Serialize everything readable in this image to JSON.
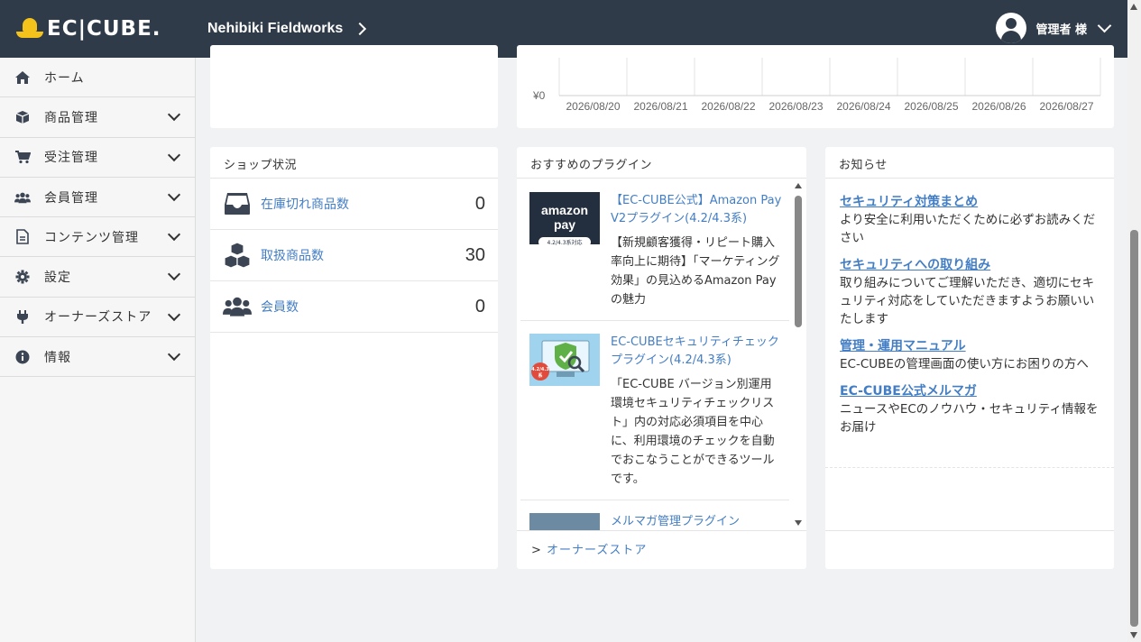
{
  "header": {
    "logo_text": "EC|CUBE.",
    "shop_name": "Nehibiki Fieldworks",
    "user_name": "管理者 様"
  },
  "sidebar": {
    "items": [
      {
        "label": "ホーム",
        "icon": "home-icon"
      },
      {
        "label": "商品管理",
        "icon": "box-icon"
      },
      {
        "label": "受注管理",
        "icon": "cart-icon"
      },
      {
        "label": "会員管理",
        "icon": "users-icon"
      },
      {
        "label": "コンテンツ管理",
        "icon": "document-icon"
      },
      {
        "label": "設定",
        "icon": "gear-icon"
      },
      {
        "label": "オーナーズストア",
        "icon": "plug-icon"
      },
      {
        "label": "情報",
        "icon": "info-icon"
      }
    ]
  },
  "chart_data": {
    "type": "line",
    "y_tick_label": "¥0",
    "categories": [
      "2026/08/20",
      "2026/08/21",
      "2026/08/22",
      "2026/08/23",
      "2026/08/24",
      "2026/08/25",
      "2026/08/26",
      "2026/08/27"
    ],
    "values": [
      0,
      0,
      0,
      0,
      0,
      0,
      0,
      0
    ]
  },
  "shop_status": {
    "title": "ショップ状況",
    "rows": [
      {
        "label": "在庫切れ商品数",
        "value": "0",
        "icon": "inbox-icon"
      },
      {
        "label": "取扱商品数",
        "value": "30",
        "icon": "cubes-icon"
      },
      {
        "label": "会員数",
        "value": "0",
        "icon": "users-icon"
      }
    ]
  },
  "plugins": {
    "title": "おすすめのプラグイン",
    "items": [
      {
        "title": "【EC-CUBE公式】Amazon Pay V2プラグイン(4.2/4.3系)",
        "desc": "【新規顧客獲得・リピート購入率向上に期待】「マーケティング効果」の見込めるAmazon Payの魅力",
        "thumb_text": "amazon pay",
        "thumb_sub": "4.2/4.3系対応"
      },
      {
        "title": "EC-CUBEセキュリティチェックプラグイン(4.2/4.3系)",
        "desc": "「EC-CUBE バージョン別運用環境セキュリティチェックリスト」内の対応必須項目を中心に、利用環境のチェックを自動でおこなうことができるツールです。",
        "thumb_badge": "4.2/4.3系"
      },
      {
        "title": "メルマガ管理プラグイン",
        "desc": ""
      }
    ],
    "footer_link": "オーナーズストア",
    "footer_prefix": ">"
  },
  "news": {
    "title": "お知らせ",
    "items": [
      {
        "title": "セキュリティ対策まとめ",
        "desc": "より安全に利用いただくために必ずお読みください"
      },
      {
        "title": "セキュリティへの取り組み",
        "desc": "取り組みについてご理解いただき、適切にセキュリティ対応をしていただきますようお願いいたします"
      },
      {
        "title": "管理・運用マニュアル",
        "desc": "EC-CUBEの管理画面の使い方にお困りの方へ"
      },
      {
        "title": "EC-CUBE公式メルマガ",
        "desc": "ニュースやECのノウハウ・セキュリティ情報をお届け"
      }
    ]
  },
  "colors": {
    "header_bg": "#2f3b48",
    "link": "#437ec4",
    "logo_yellow": "#f3c21b"
  }
}
